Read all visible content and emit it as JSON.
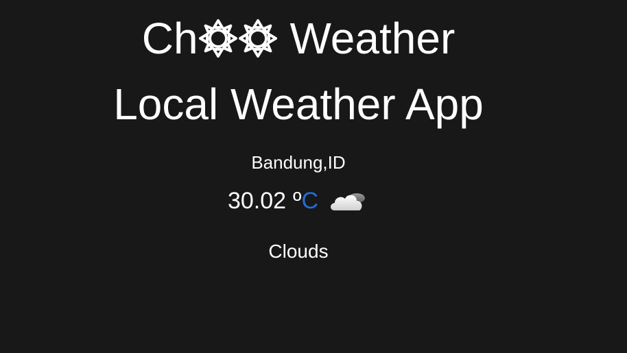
{
  "header": {
    "title_prefix": "Ch",
    "title_suffix": "Weather",
    "subtitle": "Local Weather App",
    "title_icons": [
      "sun-icon",
      "sun-icon"
    ]
  },
  "weather": {
    "location": "Bandung,ID",
    "temperature": "30.02",
    "degree_symbol": "º",
    "unit": "C",
    "condition": "Clouds",
    "condition_icon": "cloud-sun-icon"
  },
  "colors": {
    "background": "#181818",
    "text": "#ffffff",
    "unit_link": "#1e6fd9"
  }
}
